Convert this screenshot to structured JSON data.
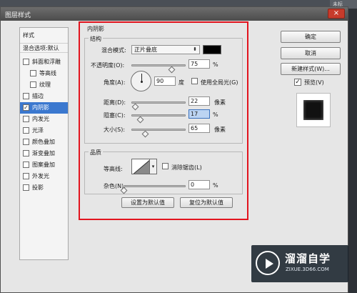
{
  "backdrop": {
    "tab_label": "未标"
  },
  "window": {
    "title": "图层样式",
    "close_label": "×"
  },
  "style_panel": {
    "header": "样式",
    "blend_header": "混合选项:默认",
    "items": [
      {
        "label": "斜面和浮雕",
        "checked": false,
        "level": 0
      },
      {
        "label": "等高线",
        "checked": false,
        "level": 1
      },
      {
        "label": "纹理",
        "checked": false,
        "level": 1
      },
      {
        "label": "描边",
        "checked": false,
        "level": 0
      },
      {
        "label": "内阴影",
        "checked": true,
        "selected": true,
        "level": 0
      },
      {
        "label": "内发光",
        "checked": false,
        "level": 0
      },
      {
        "label": "光泽",
        "checked": false,
        "level": 0
      },
      {
        "label": "颜色叠加",
        "checked": false,
        "level": 0
      },
      {
        "label": "渐变叠加",
        "checked": false,
        "level": 0
      },
      {
        "label": "图案叠加",
        "checked": false,
        "level": 0
      },
      {
        "label": "外发光",
        "checked": false,
        "level": 0
      },
      {
        "label": "投影",
        "checked": false,
        "level": 0
      }
    ]
  },
  "inner_shadow": {
    "title": "内阴影",
    "structure_title": "结构",
    "blend_mode_label": "混合模式:",
    "blend_mode_value": "正片叠底",
    "blend_color": "#000000",
    "opacity_label": "不透明度(O):",
    "opacity_value": "75",
    "opacity_unit": "%",
    "angle_label": "角度(A):",
    "angle_value": "90",
    "angle_unit": "度",
    "global_light_label": "使用全局光(G)",
    "global_light_checked": false,
    "distance_label": "距离(D):",
    "distance_value": "22",
    "distance_unit": "像素",
    "choke_label": "阻塞(C):",
    "choke_value": "17",
    "choke_unit": "%",
    "size_label": "大小(S):",
    "size_value": "65",
    "size_unit": "像素",
    "quality_title": "品质",
    "contour_label": "等高线:",
    "anti_alias_label": "消除锯齿(L)",
    "anti_alias_checked": false,
    "noise_label": "杂色(N):",
    "noise_value": "0",
    "noise_unit": "%",
    "set_default_label": "设置为默认值",
    "reset_default_label": "复位为默认值"
  },
  "sliders": {
    "opacity_fraction": 0.75,
    "distance_fraction": 0.08,
    "choke_fraction": 0.17,
    "size_fraction": 0.26,
    "noise_fraction": 0.0
  },
  "right_panel": {
    "ok_label": "确定",
    "cancel_label": "取消",
    "new_style_label": "新建样式(W)...",
    "preview_label": "预览(V)",
    "preview_checked": true
  },
  "watermark": {
    "title": "溜溜自学",
    "url": "ZIXUE.3D66.COM"
  }
}
